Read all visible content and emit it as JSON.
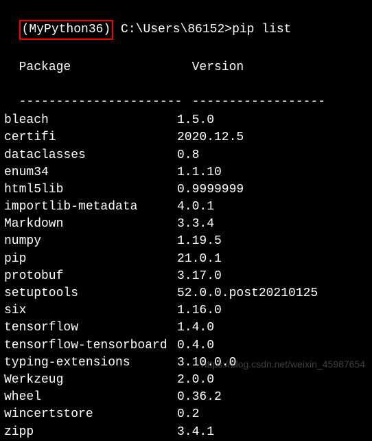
{
  "prompt": {
    "env_name": "(MyPython36)",
    "path": " C:\\Users\\86152>",
    "command": "pip list"
  },
  "headers": {
    "package": "Package",
    "version": "Version"
  },
  "separator": {
    "col1": "----------------------",
    "col2": "------------------"
  },
  "packages": [
    {
      "name": "bleach",
      "version": "1.5.0"
    },
    {
      "name": "certifi",
      "version": "2020.12.5"
    },
    {
      "name": "dataclasses",
      "version": "0.8"
    },
    {
      "name": "enum34",
      "version": "1.1.10"
    },
    {
      "name": "html5lib",
      "version": "0.9999999"
    },
    {
      "name": "importlib-metadata",
      "version": "4.0.1"
    },
    {
      "name": "Markdown",
      "version": "3.3.4"
    },
    {
      "name": "numpy",
      "version": "1.19.5"
    },
    {
      "name": "pip",
      "version": "21.0.1"
    },
    {
      "name": "protobuf",
      "version": "3.17.0"
    },
    {
      "name": "setuptools",
      "version": "52.0.0.post20210125"
    },
    {
      "name": "six",
      "version": "1.16.0"
    },
    {
      "name": "tensorflow",
      "version": "1.4.0"
    },
    {
      "name": "tensorflow-tensorboard",
      "version": "0.4.0"
    },
    {
      "name": "typing-extensions",
      "version": "3.10.0.0"
    },
    {
      "name": "Werkzeug",
      "version": "2.0.0"
    },
    {
      "name": "wheel",
      "version": "0.36.2"
    },
    {
      "name": "wincertstore",
      "version": "0.2"
    },
    {
      "name": "zipp",
      "version": "3.4.1"
    }
  ],
  "watermark": "https://blog.csdn.net/weixin_45987654"
}
